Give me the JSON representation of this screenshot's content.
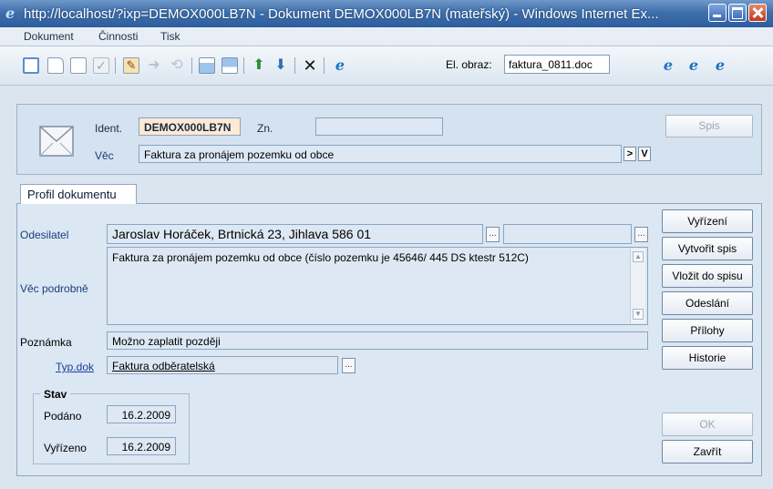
{
  "window": {
    "title": "http://localhost/?ixp=DEMOX000LB7N - Dokument DEMOX000LB7N (mateřský) - Windows Internet Ex..."
  },
  "menu": [
    "Dokument",
    "Činnosti",
    "Tisk"
  ],
  "toolbar": {
    "el_obraz_label": "El. obraz:",
    "el_obraz_value": "faktura_0811.doc"
  },
  "header": {
    "ident_label": "Ident.",
    "ident_value": "DEMOX000LB7N",
    "zn_label": "Zn.",
    "zn_value": "",
    "vec_label": "Věc",
    "vec_value": "Faktura za pronájem pozemku od obce",
    "btn_gt": ">",
    "btn_v": "V",
    "spis_button": "Spis"
  },
  "tab": {
    "label": "Profil dokumentu"
  },
  "form": {
    "odesilatel_label": "Odesilatel",
    "odesilatel_value": "Jaroslav Horáček, Brtnická 23, Jihlava 586 01",
    "odesilatel_extra": "",
    "vec_podrobne_label": "Věc podrobně",
    "vec_podrobne_value": "Faktura za pronájem pozemku od obce (číslo pozemku je 45646/ 445 DS ktestr 512C)",
    "poznamka_label": "Poznámka",
    "poznamka_value": "Možno zaplatit později",
    "typ_dok_label": "Typ.dok",
    "typ_dok_value": "Faktura odběratelská",
    "dots": "..."
  },
  "stav": {
    "legend": "Stav",
    "podano_label": "Podáno",
    "podano_value": "16.2.2009",
    "vyrizeno_label": "Vyřízeno",
    "vyrizeno_value": "16.2.2009"
  },
  "buttons": {
    "vyrizeni": "Vyřízení",
    "vytvorit_spis": "Vytvořit spis",
    "vlozit_do_spisu": "Vložit do spisu",
    "odeslani": "Odeslání",
    "prilohy": "Přílohy",
    "historie": "Historie",
    "ok": "OK",
    "zavrit": "Zavřít"
  },
  "icons": {
    "browser": "ie-logo-icon",
    "toolbar": [
      "preview-icon",
      "new-document-icon",
      "new-copy-icon",
      "check-icon",
      "edit-icon",
      "forward-icon",
      "back-icon",
      "insert-row-icon",
      "remove-row-icon",
      "move-up-icon",
      "move-down-icon",
      "delete-x-icon",
      "ie-open-icon",
      "ie-export-icon",
      "ie-print-icon",
      "ie-settings-icon"
    ]
  },
  "colors": {
    "titlebar": "#3f6fab",
    "panel": "#d5e2ef",
    "ident_bg": "#fde9d5",
    "label_blue": "#1a3d7c"
  }
}
